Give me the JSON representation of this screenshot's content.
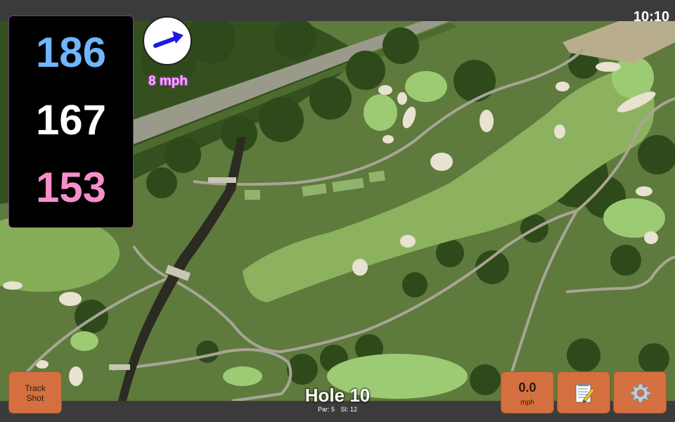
{
  "status_bar": {
    "time": "10:10"
  },
  "yardages": {
    "back": "186",
    "middle": "167",
    "front": "153"
  },
  "wind": {
    "speed": "8 mph",
    "arrow_color": "#1a1ae6"
  },
  "track_shot": {
    "line1": "Track",
    "line2": "Shot"
  },
  "speed_display": {
    "value": "0.0",
    "unit": "mph"
  },
  "hole": {
    "title": "Hole 10",
    "par": "Par: 5",
    "stroke_index": "SI: 12"
  },
  "icons": {
    "notes": "notepad-pencil-icon",
    "settings": "gear-icon"
  },
  "colors": {
    "button": "#d4703f",
    "back_yardage": "#6fb6ff",
    "middle_yardage": "#ffffff",
    "front_yardage": "#f78ecb",
    "map_rough": "#5f7a3e",
    "map_fairway": "#88ad5e"
  }
}
